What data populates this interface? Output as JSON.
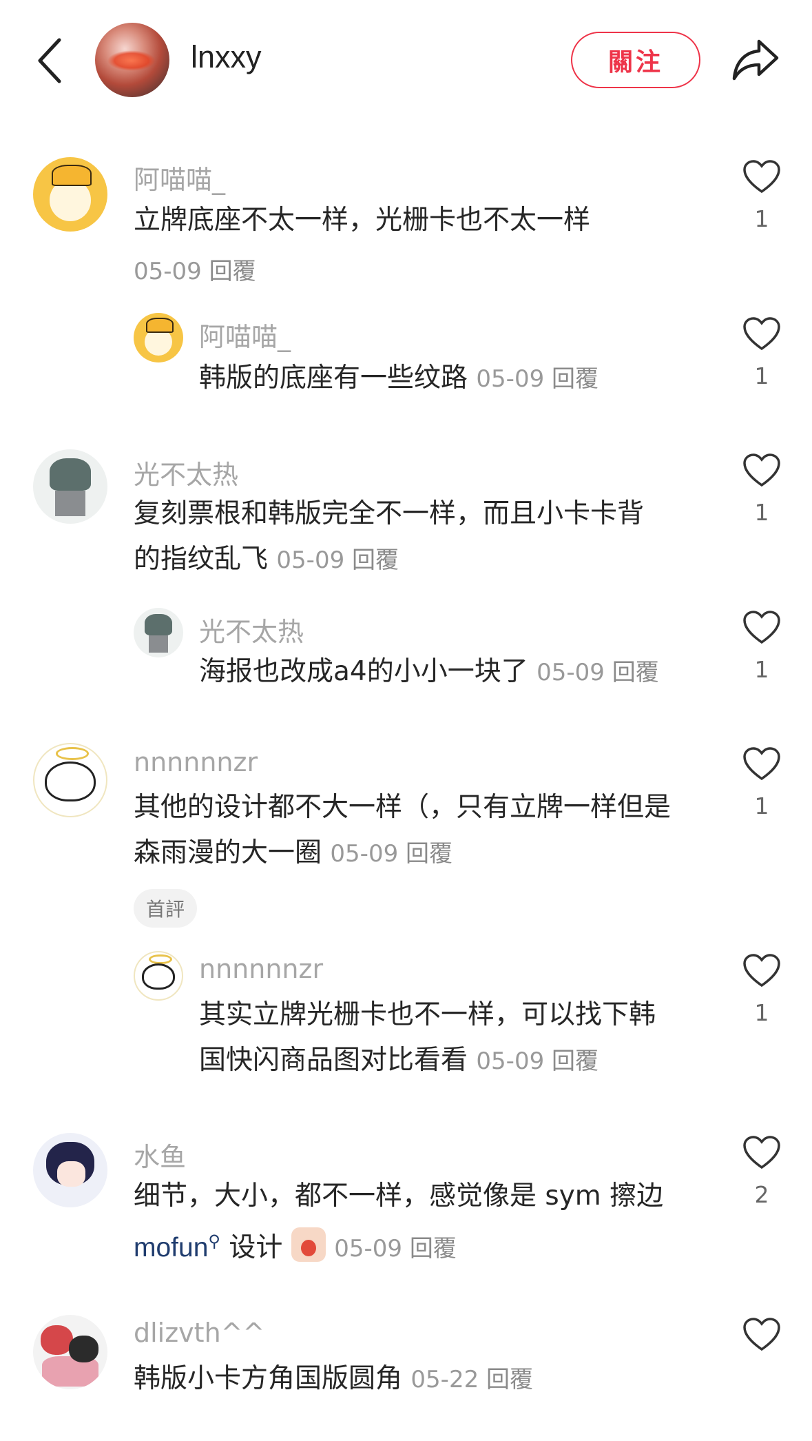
{
  "header": {
    "username": "lnxxy",
    "follow_label": "關注"
  },
  "comments": [
    {
      "user": "阿喵喵_",
      "text": "立牌底座不太一样，光栅卡也不太一样",
      "date": "05-09",
      "reply_label": "回覆",
      "likes": "1",
      "replies": [
        {
          "user": "阿喵喵_",
          "text": "韩版的底座有一些纹路",
          "date": "05-09",
          "reply_label": "回覆",
          "likes": "1"
        }
      ]
    },
    {
      "user": "光不太热",
      "text_line1": "复刻票根和韩版完全不一样，而且小卡卡背",
      "text_line2": "的指纹乱飞",
      "date": "05-09",
      "reply_label": "回覆",
      "likes": "1",
      "replies": [
        {
          "user": "光不太热",
          "text": "海报也改成a4的小小一块了",
          "date": "05-09",
          "reply_label": "回覆",
          "likes": "1"
        }
      ]
    },
    {
      "user": "nnnnnnzr",
      "text_line1": "其他的设计都不大一样（，只有立牌一样但是",
      "text_line2": "森雨漫的大一圈",
      "date": "05-09",
      "reply_label": "回覆",
      "likes": "1",
      "tag": "首評",
      "replies": [
        {
          "user": "nnnnnnzr",
          "text_line1": "其实立牌光栅卡也不一样，可以找下韩",
          "text_line2": "国快闪商品图对比看看",
          "date": "05-09",
          "reply_label": "回覆",
          "likes": "1"
        }
      ]
    },
    {
      "user": "水鱼",
      "text_line1": "细节，大小，都不一样，感觉像是 sym 擦边",
      "mention": "mofun",
      "text_after_mention": " 设计",
      "date": "05-09",
      "reply_label": "回覆",
      "likes": "2"
    },
    {
      "user": "dlizvth^^",
      "text": "韩版小卡方角国版圆角",
      "date": "05-22",
      "reply_label": "回覆"
    }
  ]
}
